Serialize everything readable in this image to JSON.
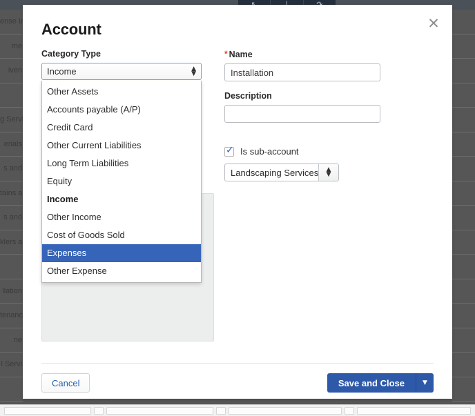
{
  "backdrop": {
    "toolbar_icons": [
      "arrow-cursor-icon",
      "pencil-icon",
      "redo-icon"
    ],
    "toolbar_glyphs": [
      "↖",
      "∣",
      "↷"
    ],
    "left_table_rows": [
      "ense In",
      "me",
      "iven",
      "",
      "g Servi",
      "erials",
      "s and",
      "tains a",
      "s and",
      "klers a",
      "",
      "llation",
      "tenanc",
      "ne",
      "l Servi",
      ""
    ],
    "footer_boxes_widths": [
      130,
      14,
      160,
      14,
      170,
      14,
      170
    ]
  },
  "modal": {
    "title": "Account",
    "close_icon": "close-icon",
    "category_type": {
      "label": "Category Type",
      "selected": "Income",
      "stepper_icon": "stepper-updown-icon",
      "options": [
        {
          "label": "Other Assets",
          "group": false,
          "selected": false
        },
        {
          "label": "Accounts payable (A/P)",
          "group": false,
          "selected": false
        },
        {
          "label": "Credit Card",
          "group": false,
          "selected": false
        },
        {
          "label": "Other Current Liabilities",
          "group": false,
          "selected": false
        },
        {
          "label": "Long Term Liabilities",
          "group": false,
          "selected": false
        },
        {
          "label": "Equity",
          "group": false,
          "selected": false
        },
        {
          "label": "Income",
          "group": true,
          "selected": false
        },
        {
          "label": "Other Income",
          "group": false,
          "selected": false
        },
        {
          "label": "Cost of Goods Sold",
          "group": false,
          "selected": false
        },
        {
          "label": "Expenses",
          "group": false,
          "selected": true
        },
        {
          "label": "Other Expense",
          "group": false,
          "selected": false
        }
      ]
    },
    "name_field": {
      "label": "Name",
      "required_marker": "*",
      "value": "Installation",
      "placeholder": ""
    },
    "description_field": {
      "label": "Description",
      "value": "",
      "placeholder": ""
    },
    "sub_account": {
      "label": "Is sub-account",
      "checked": true,
      "check_glyph": "✓",
      "parent_value": "Landscaping Services:L",
      "stepper_icon": "stepper-updown-icon"
    },
    "footer": {
      "cancel_label": "Cancel",
      "save_label": "Save and Close",
      "save_dropdown_icon": "chevron-down-icon",
      "save_dropdown_glyph": "▼"
    }
  },
  "colors": {
    "accent_blue": "#2e59a8",
    "selected_blue": "#3664b8",
    "link_blue": "#2a5db0",
    "required_red": "#e0422a",
    "backdrop_grey": "#565656",
    "disabled_panel": "#eceded"
  }
}
